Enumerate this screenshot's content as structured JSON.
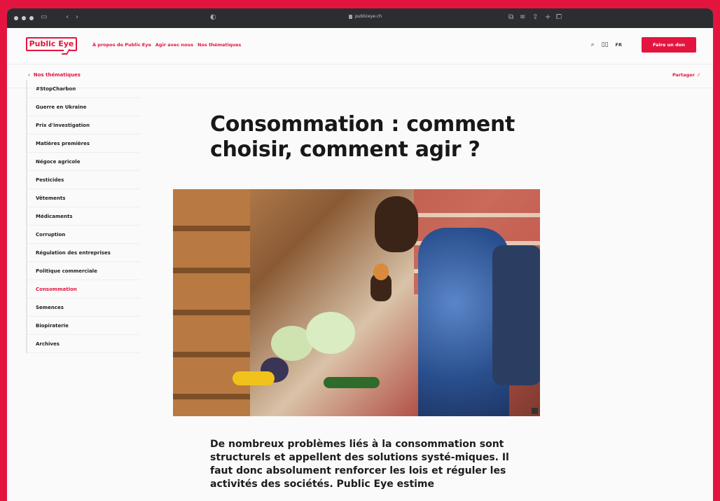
{
  "browser": {
    "url": "publiceye.ch"
  },
  "site": {
    "logo": "Public Eye",
    "nav": [
      "À propos de Public Eye",
      "Agir avec nous",
      "Nos thématiques"
    ],
    "lang": "FR",
    "donate": "Faire un don"
  },
  "subbar": {
    "back_label": "Nos thématiques",
    "share_label": "Partager"
  },
  "sidebar": {
    "items": [
      "#StopCharbon",
      "Guerre en Ukraine",
      "Prix d'investigation",
      "Matières premières",
      "Négoce agricole",
      "Pesticides",
      "Vêtements",
      "Médicaments",
      "Corruption",
      "Régulation des entreprises",
      "Politique commerciale",
      "Consommation",
      "Semences",
      "Biopiraterie",
      "Archives"
    ],
    "active_index": 11
  },
  "article": {
    "title": "Consommation : comment choisir, comment agir ?",
    "lead": "De nombreux problèmes liés à la consommation sont structurels et appellent des solutions systé-miques. Il faut donc absolument renforcer les lois et réguler les activités des sociétés. Public Eye estime"
  },
  "colors": {
    "accent": "#e3153f",
    "text": "#1c1c1c",
    "background": "#fafafa"
  }
}
